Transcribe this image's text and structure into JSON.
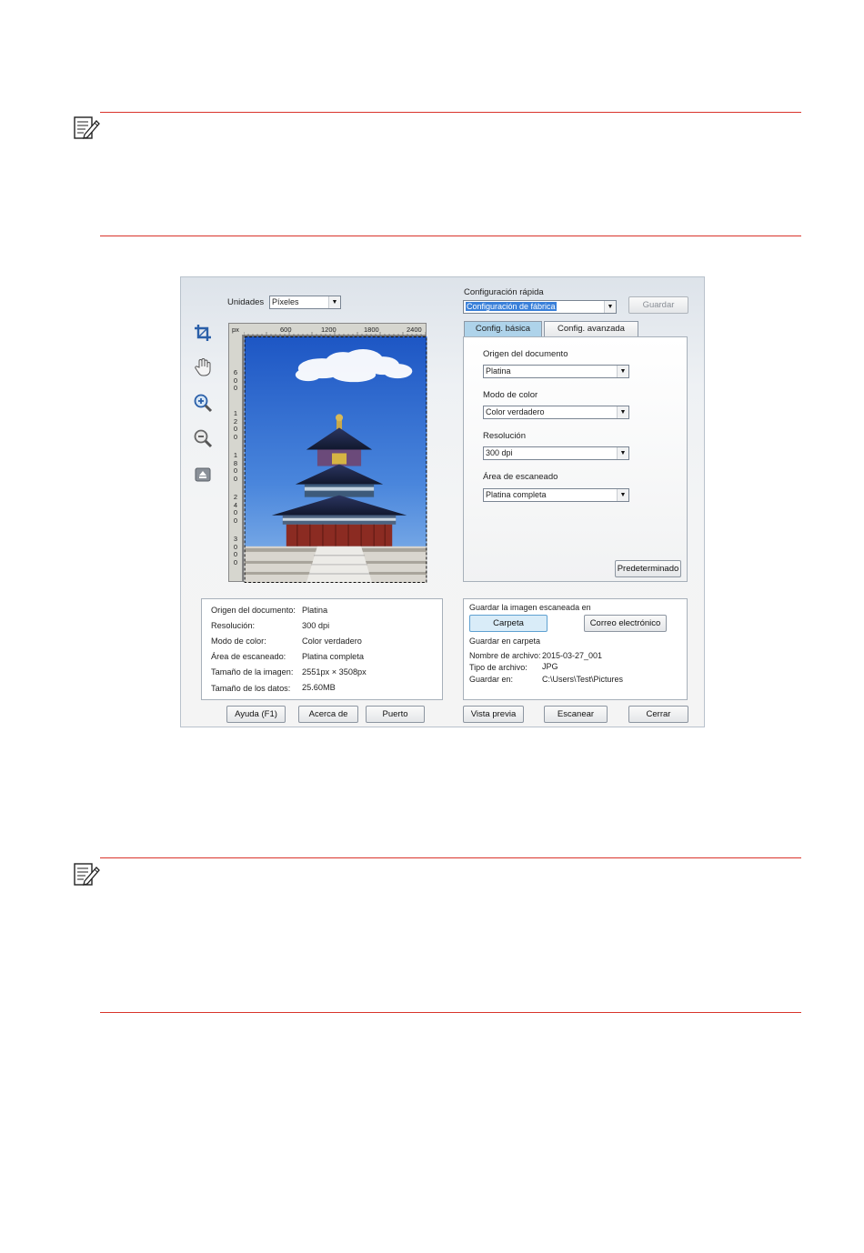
{
  "scanner": {
    "units_label": "Unidades",
    "units_value": "Píxeles",
    "quick_config_label": "Configuración rápida",
    "quick_config_value": "Configuración de fábrica",
    "save_button": "Guardar",
    "tools": [
      "crop-icon",
      "hand-icon",
      "zoom-in-icon",
      "zoom-out-icon",
      "eject-icon"
    ],
    "ruler": {
      "unit": "px",
      "h_ticks": [
        "600",
        "1200",
        "1800",
        "2400"
      ],
      "v_ticks": [
        "600",
        "1200",
        "1800",
        "2400",
        "3000"
      ]
    },
    "tabs": [
      "Config. básica",
      "Config. avanzada"
    ],
    "basic": {
      "origin_label": "Origen del documento",
      "origin_value": "Platina",
      "color_label": "Modo de color",
      "color_value": "Color verdadero",
      "resolution_label": "Resolución",
      "resolution_value": "300 dpi",
      "area_label": "Área de escaneado",
      "area_value": "Platina completa",
      "default_button": "Predeterminado"
    },
    "info": [
      {
        "key": "Origen del documento:",
        "value": "Platina"
      },
      {
        "key": "Resolución:",
        "value": "300 dpi"
      },
      {
        "key": "Modo de color:",
        "value": "Color verdadero"
      },
      {
        "key": "Área de escaneado:",
        "value": "Platina completa"
      },
      {
        "key": "Tamaño de la imagen:",
        "value": "2551px × 3508px"
      },
      {
        "key": "Tamaño de los datos:",
        "value": "25.60MB"
      }
    ],
    "save_panel": {
      "title": "Guardar la imagen escaneada en",
      "folder_button": "Carpeta",
      "email_button": "Correo electrónico",
      "subtitle": "Guardar en carpeta",
      "rows": [
        {
          "key": "Nombre de archivo:",
          "value": "2015-03-27_001"
        },
        {
          "key": "Tipo de archivo:",
          "value": "JPG"
        },
        {
          "key": "Guardar en:",
          "value": "C:\\Users\\Test\\Pictures"
        }
      ]
    },
    "buttons": {
      "help": "Ayuda (F1)",
      "about": "Acerca de",
      "port": "Puerto",
      "preview": "Vista previa",
      "scan": "Escanear",
      "close": "Cerrar"
    }
  },
  "colors": {
    "rule": "#d9342b",
    "tab_active": "#aed3ea",
    "button_selected": "#d9ecf8"
  }
}
